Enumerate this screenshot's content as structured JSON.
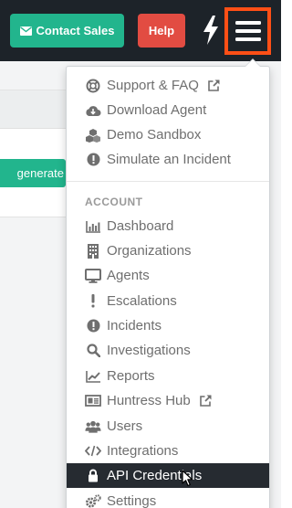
{
  "navbar": {
    "contact_sales_label": "Contact Sales",
    "contact_sales_icon": "envelope-icon",
    "help_label": "Help",
    "bolt_icon": "lightning-bolt-icon",
    "menu_icon": "hamburger-menu-icon",
    "colors": {
      "bar": "#1d2329",
      "contact_sales": "#22b58d",
      "help": "#e24c42",
      "menu_highlight": "#ff4f16"
    }
  },
  "background": {
    "generate_button_label": "generate"
  },
  "dropdown": {
    "top_items": [
      {
        "label": "Support & FAQ",
        "icon": "life-ring-icon",
        "external": true
      },
      {
        "label": "Download Agent",
        "icon": "cloud-download-icon",
        "external": false
      },
      {
        "label": "Demo Sandbox",
        "icon": "cubes-icon",
        "external": false
      },
      {
        "label": "Simulate an Incident",
        "icon": "exclamation-circle-icon",
        "external": false
      }
    ],
    "section_header": "ACCOUNT",
    "account_items": [
      {
        "label": "Dashboard",
        "icon": "bar-chart-icon",
        "external": false
      },
      {
        "label": "Organizations",
        "icon": "building-icon",
        "external": false
      },
      {
        "label": "Agents",
        "icon": "monitor-icon",
        "external": false
      },
      {
        "label": "Escalations",
        "icon": "exclamation-icon",
        "external": false
      },
      {
        "label": "Incidents",
        "icon": "exclamation-circle-icon",
        "external": false
      },
      {
        "label": "Investigations",
        "icon": "magnifier-icon",
        "external": false
      },
      {
        "label": "Reports",
        "icon": "line-chart-icon",
        "external": false
      },
      {
        "label": "Huntress Hub",
        "icon": "id-card-icon",
        "external": true
      },
      {
        "label": "Users",
        "icon": "users-icon",
        "external": false
      },
      {
        "label": "Integrations",
        "icon": "code-icon",
        "external": false
      },
      {
        "label": "API Credentials",
        "icon": "lock-icon",
        "external": false,
        "active": true
      },
      {
        "label": "Settings",
        "icon": "gears-icon",
        "external": false
      }
    ],
    "colors": {
      "item_text": "#6f6f6f",
      "active_bg": "#262b31",
      "header": "#9a9a9a"
    }
  }
}
